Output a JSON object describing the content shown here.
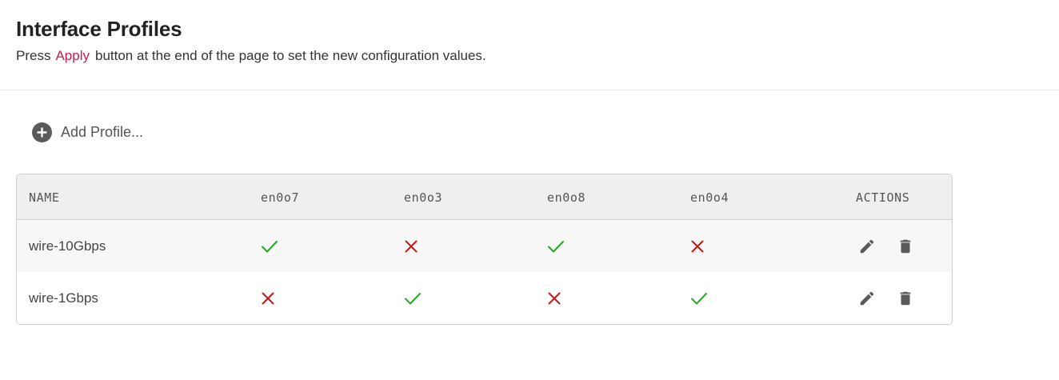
{
  "header": {
    "title": "Interface Profiles",
    "subtitle_pre": "Press",
    "subtitle_link": "Apply",
    "subtitle_post": "button at the end of the page to set the new configuration values."
  },
  "add_profile": {
    "label": "Add Profile...",
    "icon": "plus-circle-icon"
  },
  "table": {
    "columns": [
      "NAME",
      "en0o7",
      "en0o3",
      "en0o8",
      "en0o4",
      "ACTIONS"
    ],
    "rows": [
      {
        "name": "wire-10Gbps",
        "values": [
          true,
          false,
          true,
          false
        ]
      },
      {
        "name": "wire-1Gbps",
        "values": [
          false,
          true,
          false,
          true
        ]
      }
    ],
    "actions": [
      "edit-icon",
      "delete-icon"
    ]
  },
  "colors": {
    "check": "#2aa52a",
    "cross": "#c41818",
    "link": "#c0214f",
    "icon": "#5a5a5a"
  }
}
